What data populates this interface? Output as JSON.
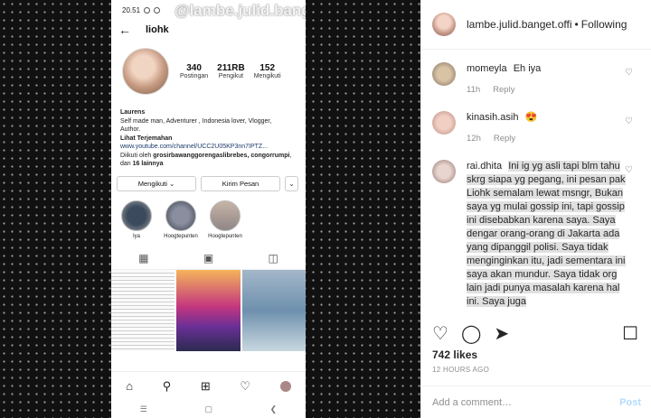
{
  "phone": {
    "status_time": "20.51",
    "watermark": "@lambe.julid.banget.official",
    "username": "liohk",
    "stats": [
      {
        "num": "340",
        "label": "Postingan"
      },
      {
        "num": "211RB",
        "label": "Pengikut"
      },
      {
        "num": "152",
        "label": "Mengikuti"
      }
    ],
    "bio_name": "Laurens",
    "bio_line1": "Self made man, Adventurer , Indonesia lover, Vlogger,",
    "bio_line2": "Author.",
    "bio_translate": "Lihat Terjemahan",
    "bio_link": "www.youtube.com/channel/UCC2U05KP3nn7IPTZ...",
    "followed_by_prefix": "Diikuti oleh",
    "followed_by_names": "grosirbawanggorengaslibrebes, congorrumpi",
    "followed_by_suffix": ", dan",
    "followed_by_count": "16 lainnya",
    "btn_following": "Mengikuti ⌄",
    "btn_message": "Kirim Pesan",
    "btn_more": "⌄",
    "highlights": [
      {
        "label": "Iya"
      },
      {
        "label": "Hoogtepunten"
      },
      {
        "label": "Hoogtepunten"
      }
    ]
  },
  "panel": {
    "username": "lambe.julid.banget.offi",
    "dot": "•",
    "following": "Following",
    "comments": [
      {
        "user": "momeyla",
        "text": "Eh iya",
        "time": "11h",
        "reply": "Reply"
      },
      {
        "user": "kinasih.asih",
        "text": "😍",
        "time": "12h",
        "reply": "Reply"
      },
      {
        "user": "rai.dhita",
        "text": "Ini ig yg asli tapi blm tahu skrg siapa yg pegang, ini pesan pak Liohk semalam lewat msngr, Bukan saya yg mulai gossip ini, tapi gossip ini disebabkan karena saya. Saya dengar orang-orang di Jakarta ada yang dipanggil polisi. Saya tidak menginginkan itu, jadi sementara ini saya akan mundur. Saya tidak org lain jadi punya masalah karena hal ini. Saya juga"
      }
    ],
    "likes": "742 likes",
    "time_ago": "12 HOURS AGO",
    "comment_placeholder": "Add a comment…",
    "post_label": "Post"
  }
}
